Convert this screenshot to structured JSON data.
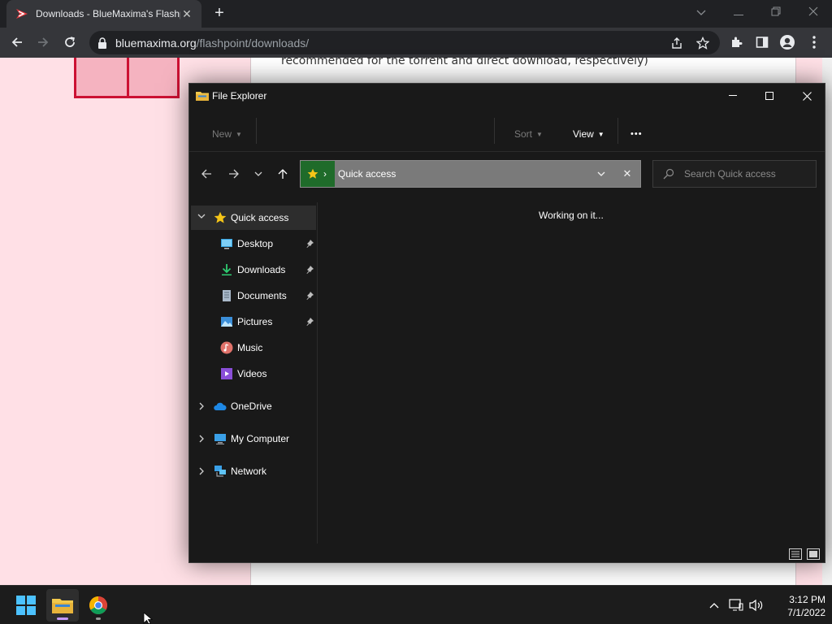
{
  "browser": {
    "tab_title": "Downloads - BlueMaxima's Flashpoint",
    "tab_close": "✕",
    "new_tab": "+",
    "url_host": "bluemaxima.org",
    "url_path": "/flashpoint/downloads/"
  },
  "page": {
    "text_line": "recommended for the torrent and direct download, respectively)"
  },
  "explorer": {
    "title": "File Explorer",
    "cmd": {
      "new_label": "New",
      "sort_label": "Sort",
      "view_label": "View",
      "more_label": "•••"
    },
    "address": {
      "location": "Quick access",
      "chevron": "›",
      "clear": "✕"
    },
    "search": {
      "placeholder": "Search Quick access"
    },
    "nav": {
      "quick_access": "Quick access",
      "desktop": "Desktop",
      "downloads": "Downloads",
      "documents": "Documents",
      "pictures": "Pictures",
      "music": "Music",
      "videos": "Videos",
      "onedrive": "OneDrive",
      "my_computer": "My Computer",
      "network": "Network"
    },
    "status": "Working on it..."
  },
  "taskbar": {
    "time": "3:12 PM",
    "date": "7/1/2022"
  },
  "colors": {
    "page_bg": "#ffe0e6",
    "accent_red": "#cc1133",
    "explorer_bg": "#191919",
    "address_bg": "#7a7a7a",
    "quick_access_green": "#1f6b2a"
  }
}
